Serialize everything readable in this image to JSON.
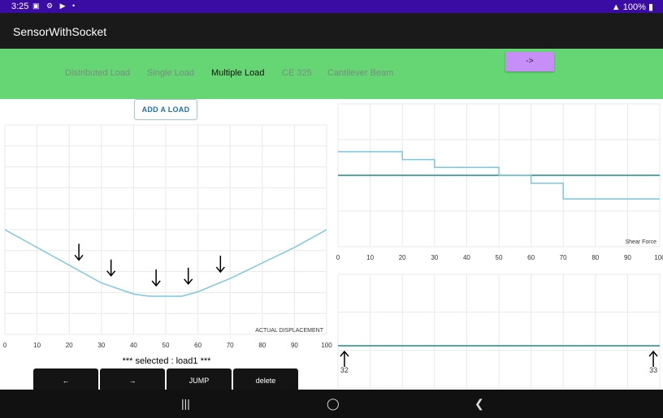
{
  "status_bar": {
    "time": "3:25",
    "battery": "100%"
  },
  "app": {
    "title": "SensorWithSocket"
  },
  "tabs": [
    {
      "label": "Distributed Load"
    },
    {
      "label": "Single Load"
    },
    {
      "label": "Multiple Load"
    },
    {
      "label": "CE 325"
    },
    {
      "label": "Cantilever Beam"
    }
  ],
  "active_tab": "Multiple Load",
  "forward_button": "->",
  "add_load_button": "ADD A LOAD",
  "selected_text": "*** selected : load1 ***",
  "controls": {
    "prev": "←",
    "next": "→",
    "jump": "JUMP",
    "delete": "delete"
  },
  "colors": {
    "accent_green": "#65d673",
    "button_purple": "#c78ef7",
    "curve": "#7ac7e0",
    "teal": "#1e8a8e"
  },
  "chart_data": [
    {
      "type": "line",
      "name": "displacement",
      "title": "ACTUAL DISPLACEMENT",
      "xlabel": "",
      "ylabel": "",
      "xlim": [
        0,
        100
      ],
      "x_ticks": [
        "0",
        "10",
        "20",
        "30",
        "40",
        "50",
        "60",
        "70",
        "80",
        "90",
        "100"
      ],
      "x": [
        0,
        10,
        20,
        30,
        40,
        45,
        50,
        55,
        60,
        70,
        80,
        90,
        100
      ],
      "y": [
        0,
        -8,
        -16,
        -24,
        -29,
        -30,
        -30,
        -30,
        -28,
        -22,
        -15,
        -8,
        0
      ],
      "loads_x": [
        23,
        33,
        47,
        57,
        67
      ],
      "grid": true
    },
    {
      "type": "line",
      "name": "shear",
      "title": "Shear Force",
      "xlabel": "",
      "ylabel": "",
      "xlim": [
        0,
        100
      ],
      "x_ticks": [
        "0",
        "10",
        "20",
        "30",
        "40",
        "50",
        "60",
        "70",
        "80",
        "90",
        "100"
      ],
      "step_x": [
        0,
        20,
        30,
        50,
        60,
        70,
        100
      ],
      "step_y": [
        3,
        2,
        1,
        0,
        -1,
        -3,
        -3
      ],
      "zero_line": 0,
      "grid": true
    },
    {
      "type": "line",
      "name": "reactions",
      "xlim": [
        0,
        100
      ],
      "reactions": [
        {
          "x": 2,
          "label": "32"
        },
        {
          "x": 98,
          "label": "33"
        }
      ],
      "grid": true
    }
  ]
}
